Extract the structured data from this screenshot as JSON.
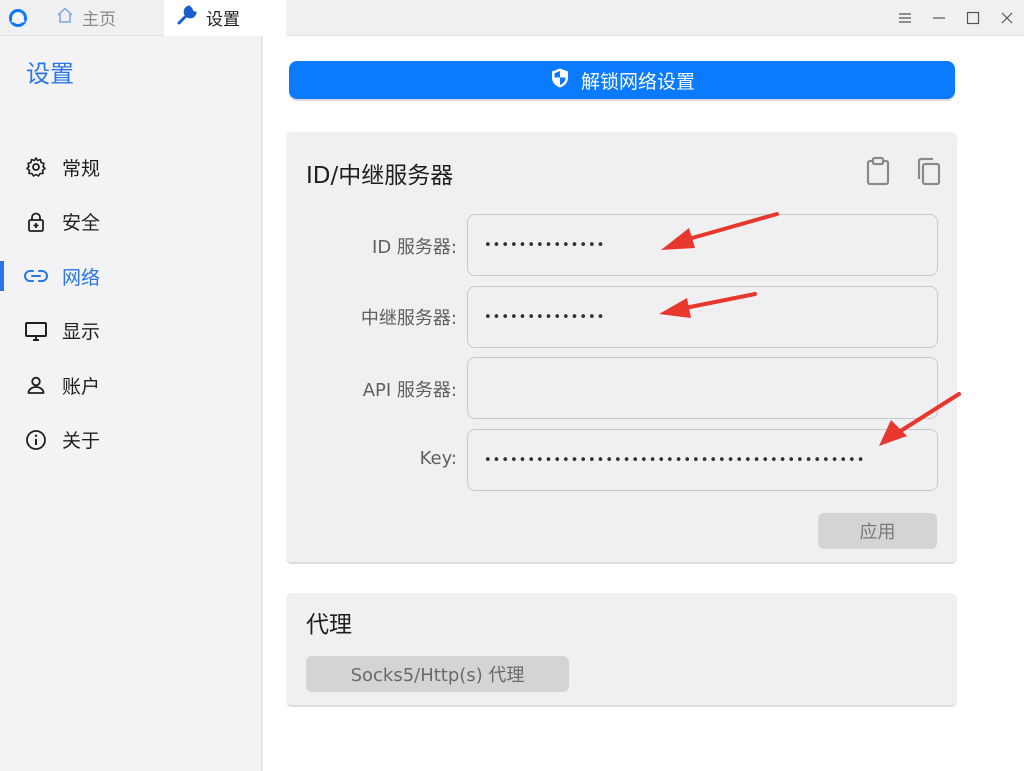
{
  "tabs": [
    {
      "label": "主页",
      "icon": "home-icon"
    },
    {
      "label": "设置",
      "icon": "wrench-icon"
    }
  ],
  "sidebar": {
    "title": "设置",
    "items": [
      {
        "label": "常规",
        "icon": "gear-icon"
      },
      {
        "label": "安全",
        "icon": "lock-icon"
      },
      {
        "label": "网络",
        "icon": "link-icon",
        "active": true
      },
      {
        "label": "显示",
        "icon": "monitor-icon"
      },
      {
        "label": "账户",
        "icon": "user-icon"
      },
      {
        "label": "关于",
        "icon": "info-icon"
      }
    ]
  },
  "main": {
    "unlock_label": "解锁网络设置",
    "server_card": {
      "title": "ID/中继服务器",
      "fields": [
        {
          "label": "ID 服务器:",
          "value": "••••••••••••••"
        },
        {
          "label": "中继服务器:",
          "value": "••••••••••••••"
        },
        {
          "label": "API 服务器:",
          "value": ""
        },
        {
          "label": "Key:",
          "value": "••••••••••••••••••••••••••••••••••••••••••••"
        }
      ],
      "apply_label": "应用"
    },
    "proxy_card": {
      "title": "代理",
      "button_label": "Socks5/Http(s) 代理"
    }
  },
  "colors": {
    "accent": "#2a76e8",
    "primary_button": "#0a7bff",
    "annotation_arrow": "#e8372c"
  }
}
